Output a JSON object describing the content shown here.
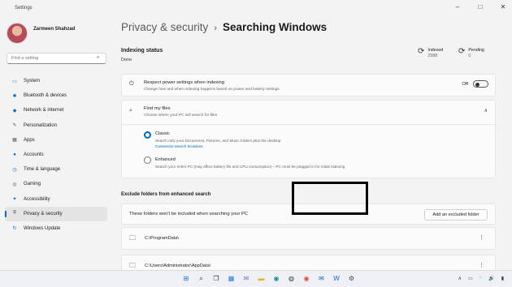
{
  "window": {
    "title": "Settings",
    "controls": [
      "–",
      "□",
      "✕"
    ]
  },
  "sidebar": {
    "profile_name": "Zarmeen Shahzad",
    "search_placeholder": "Find a setting",
    "search_icon": "⌕",
    "items": [
      {
        "label": "System",
        "icon": "▭",
        "icon_name": "monitor-icon"
      },
      {
        "label": "Bluetooth & devices",
        "icon": "✱",
        "icon_name": "bluetooth-icon"
      },
      {
        "label": "Network & internet",
        "icon": "◆",
        "icon_name": "network-icon"
      },
      {
        "label": "Personalization",
        "icon": "✎",
        "icon_name": "brush-icon"
      },
      {
        "label": "Apps",
        "icon": "▦",
        "icon_name": "apps-icon"
      },
      {
        "label": "Accounts",
        "icon": "●",
        "icon_name": "person-icon"
      },
      {
        "label": "Time & language",
        "icon": "◷",
        "icon_name": "clock-globe-icon"
      },
      {
        "label": "Gaming",
        "icon": "◎",
        "icon_name": "gamepad-icon"
      },
      {
        "label": "Accessibility",
        "icon": "✦",
        "icon_name": "accessibility-icon"
      },
      {
        "label": "Privacy & security",
        "icon": "⛨",
        "icon_name": "shield-icon"
      },
      {
        "label": "Windows Update",
        "icon": "↻",
        "icon_name": "update-icon"
      }
    ],
    "active_index": 9
  },
  "header": {
    "parent": "Privacy & security",
    "separator": "›",
    "current": "Searching Windows"
  },
  "indexing": {
    "title": "Indexing status",
    "status": "Done",
    "indexed_label": "Indexed",
    "indexed_value": "2588",
    "pending_label": "Pending",
    "pending_value": "0"
  },
  "power": {
    "title": "Respect power settings when indexing",
    "subtitle": "Change how and when indexing happens based on power and battery settings",
    "toggle_label": "Off",
    "toggle_on": false
  },
  "find_files": {
    "title": "Find my files",
    "subtitle": "Choose where your PC will search for files",
    "expand_icon": "∧",
    "options": [
      {
        "title": "Classic",
        "subtitle": "Search only your Documents, Pictures, and Music folders plus the desktop",
        "link": "Customize search locations",
        "checked": true
      },
      {
        "title": "Enhanced",
        "subtitle": "Search your entire PC (may affect battery life and CPU consumption) – PC must be plugged in for initial indexing",
        "link": "",
        "checked": false
      }
    ]
  },
  "exclude": {
    "heading": "Exclude folders from enhanced search",
    "description": "These folders won't be included when searching your PC",
    "add_button": "Add an excluded folder",
    "folders": [
      "C:\\ProgramData\\",
      "C:\\Users\\Administrator\\AppData\\"
    ],
    "more_icon": "⋮",
    "folder_icon": "🗀"
  },
  "taskbar": {
    "icons": [
      {
        "glyph": "⊞",
        "name": "start-icon",
        "color": "#1e6fd9"
      },
      {
        "glyph": "⌕",
        "name": "search-icon",
        "color": "#333333"
      },
      {
        "glyph": "❐",
        "name": "task-view-icon",
        "color": "#333333"
      },
      {
        "glyph": "▦",
        "name": "widgets-icon",
        "color": "#2b79d8"
      },
      {
        "glyph": "✉",
        "name": "chat-icon",
        "color": "#7b61d9"
      },
      {
        "glyph": "▬",
        "name": "file-explorer-icon",
        "color": "#e8b21c"
      },
      {
        "glyph": "◉",
        "name": "edge-icon",
        "color": "#1a8e9c"
      },
      {
        "glyph": "◍",
        "name": "store-icon",
        "color": "#3a3a3a"
      },
      {
        "glyph": "◉",
        "name": "chrome-icon",
        "color": "#e24c3c"
      },
      {
        "glyph": "✉",
        "name": "mail-icon",
        "color": "#0b63c4"
      },
      {
        "glyph": "W",
        "name": "word-icon",
        "color": "#1f5fbf"
      },
      {
        "glyph": "⚙",
        "name": "settings-icon",
        "color": "#4a4a4a"
      }
    ],
    "tray": [
      "∧",
      "▭",
      "◌",
      "🔊",
      "▮"
    ]
  }
}
